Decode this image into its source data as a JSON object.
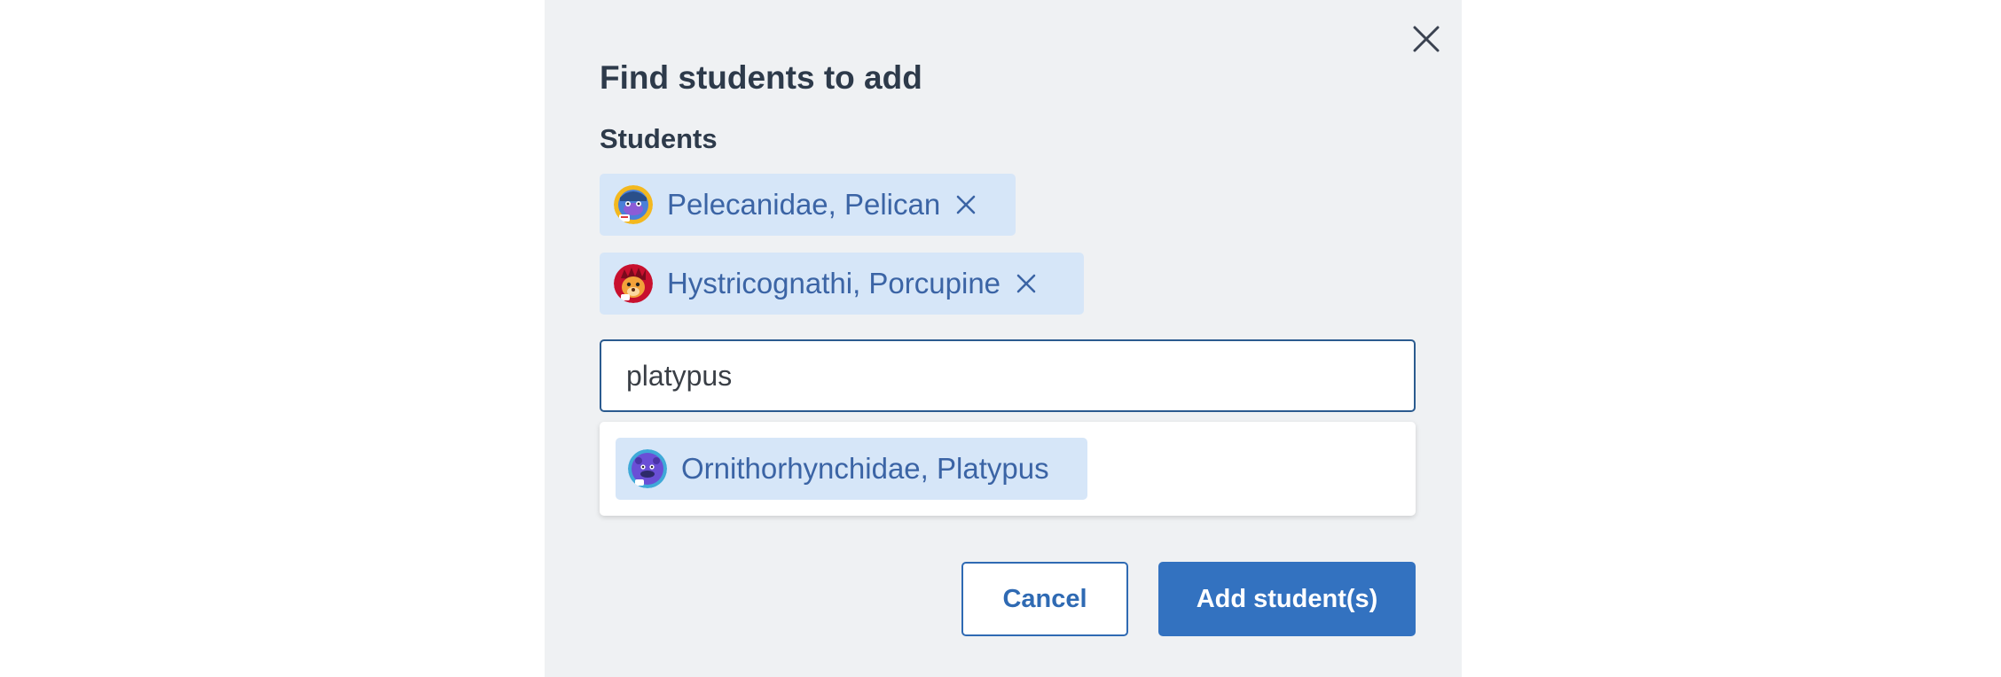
{
  "dialog": {
    "title": "Find students to add",
    "students_label": "Students",
    "selected_students": [
      {
        "name": "Pelecanidae, Pelican",
        "avatar": "pelican-avatar-icon"
      },
      {
        "name": "Hystricognathi, Porcupine",
        "avatar": "porcupine-avatar-icon"
      }
    ],
    "search": {
      "value": "platypus",
      "placeholder": ""
    },
    "suggestions": [
      {
        "name": "Ornithorhynchidae, Platypus",
        "avatar": "platypus-avatar-icon"
      }
    ],
    "buttons": {
      "cancel": "Cancel",
      "add": "Add student(s)"
    }
  },
  "colors": {
    "modal_bg": "#eff1f3",
    "chip_bg": "#d6e6f8",
    "chip_text": "#3b64a5",
    "primary": "#3372c0",
    "title_text": "#2d3a4a"
  }
}
